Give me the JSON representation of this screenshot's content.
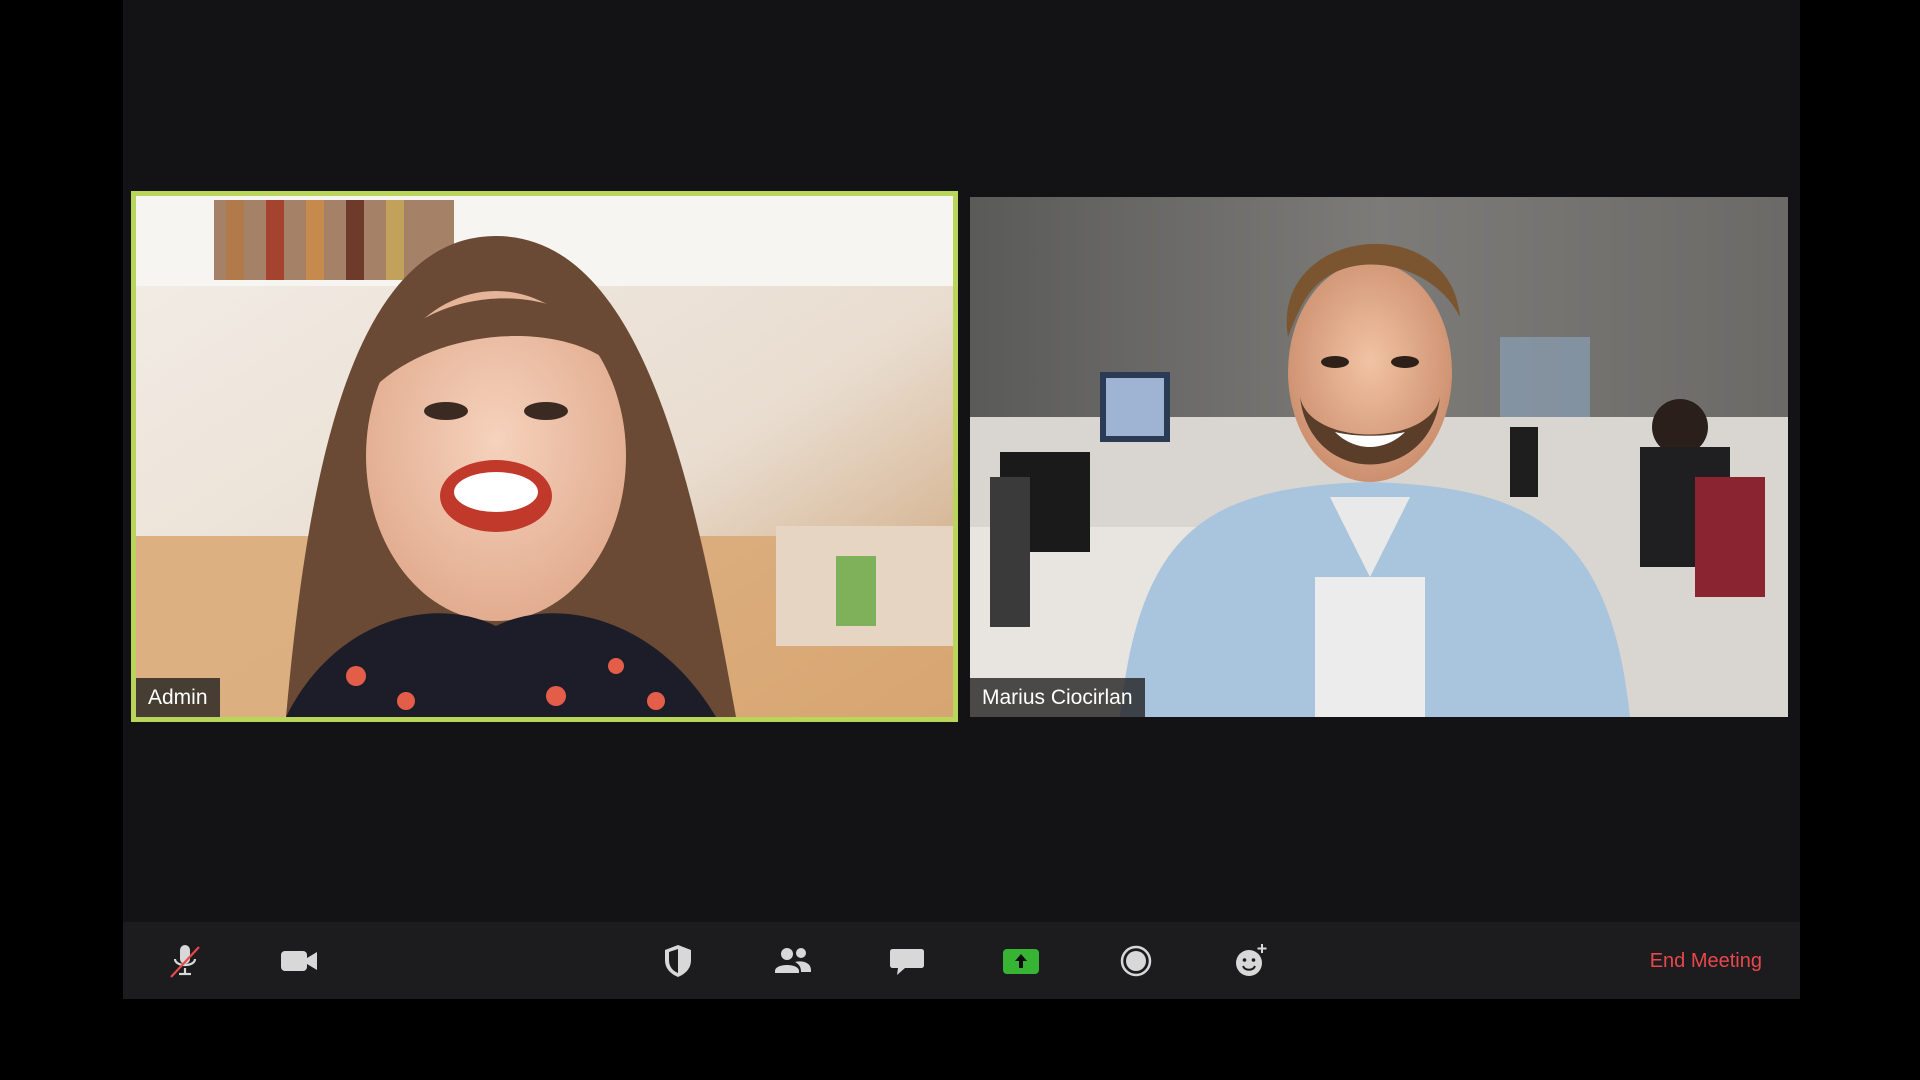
{
  "participants": [
    {
      "name": "Admin",
      "active_speaker": true
    },
    {
      "name": "Marius Ciocirlan",
      "active_speaker": false
    }
  ],
  "toolbar": {
    "buttons": [
      {
        "id": "mute",
        "icon": "microphone-muted-icon"
      },
      {
        "id": "video",
        "icon": "video-camera-icon"
      },
      {
        "id": "security",
        "icon": "shield-icon"
      },
      {
        "id": "participants",
        "icon": "participants-icon"
      },
      {
        "id": "chat",
        "icon": "chat-bubble-icon"
      },
      {
        "id": "share-screen",
        "icon": "share-screen-icon"
      },
      {
        "id": "record",
        "icon": "record-icon"
      },
      {
        "id": "reactions",
        "icon": "reaction-emoji-icon"
      }
    ],
    "end_meeting_label": "End Meeting"
  },
  "colors": {
    "active_speaker_border": "#b9d65a",
    "end_meeting": "#e8474b",
    "share_button": "#38b435",
    "background": "#131315",
    "toolbar": "#1c1c1e"
  }
}
